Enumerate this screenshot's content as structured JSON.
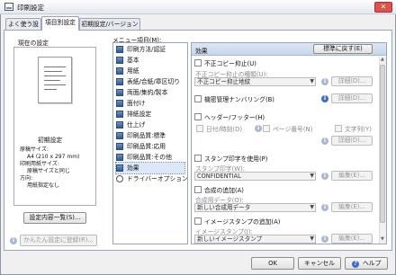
{
  "window": {
    "title": "印刷設定",
    "close_label": "✕"
  },
  "tabs": [
    {
      "label": "よく使う設定"
    },
    {
      "label": "項目別設定"
    },
    {
      "label": "初期設定/バージョン"
    }
  ],
  "left": {
    "current_settings_label": "現在の設定",
    "preview_title": "初期設定",
    "preview_lines": [
      "原稿サイズ:",
      "A4 (210 x 297 mm)",
      "印刷用紙サイズ:",
      "原稿サイズと同じ",
      "方向:",
      "用紙指定なし"
    ],
    "list_button": "設定内容一覧(S)...",
    "simple_register_button": "かんたん設定に登録(R)..."
  },
  "menu": {
    "label": "メニュー項目(M):",
    "items": [
      {
        "label": "印刷方法/認証"
      },
      {
        "label": "基本"
      },
      {
        "label": "用紙"
      },
      {
        "label": "表紙/合紙/章区切り"
      },
      {
        "label": "両面/集約/製本"
      },
      {
        "label": "面付け"
      },
      {
        "label": "排紙設定"
      },
      {
        "label": "仕上げ"
      },
      {
        "label": "印刷品質:標準"
      },
      {
        "label": "印刷品質:応用"
      },
      {
        "label": "印刷品質:その他"
      },
      {
        "label": "効果"
      },
      {
        "label": "ドライバーオプション"
      }
    ],
    "selected_index": 11
  },
  "effects": {
    "header": "効果",
    "reset_button": "標準に戻す(E)",
    "unauthorized_copy": {
      "label": "不正コピー抑止(U)",
      "type_label": "不正コピー抑止の種類(U):",
      "type_value": "不正コピー抑止地紋",
      "detail": "詳細(D)..."
    },
    "confidential_numbering": {
      "label": "機密管理ナンバリング(B)",
      "detail": "詳細(D)..."
    },
    "header_footer": {
      "label": "ヘッダー/フッター(H)",
      "datetime": "日付/時刻(D)",
      "page_number": "ページ番号(N)",
      "text": "文字列(Y)",
      "detail": "詳細(D)..."
    },
    "stamp": {
      "label": "スタンプ印字を使用(P)",
      "stamp_label": "スタンプ印字(W):",
      "stamp_value": "CONFIDENTIAL",
      "edit": "編集(E)..."
    },
    "form": {
      "label": "合成の追加(A)",
      "form_label": "合成用データ(O):",
      "form_value": "新しい合成用データ",
      "edit": "編集(E)..."
    },
    "image_stamp": {
      "label": "イメージスタンプの追加(A)",
      "image_label": "イメージスタンプ(J):",
      "image_value": "新しいイメージスタンプ",
      "edit": "編集(E)..."
    }
  },
  "buttons": {
    "ok": "OK",
    "cancel": "キャンセル",
    "help": "ヘルプ"
  },
  "icons": {
    "info": "info-icon",
    "dropdown": "chevron-down-icon",
    "help": "help-icon"
  }
}
